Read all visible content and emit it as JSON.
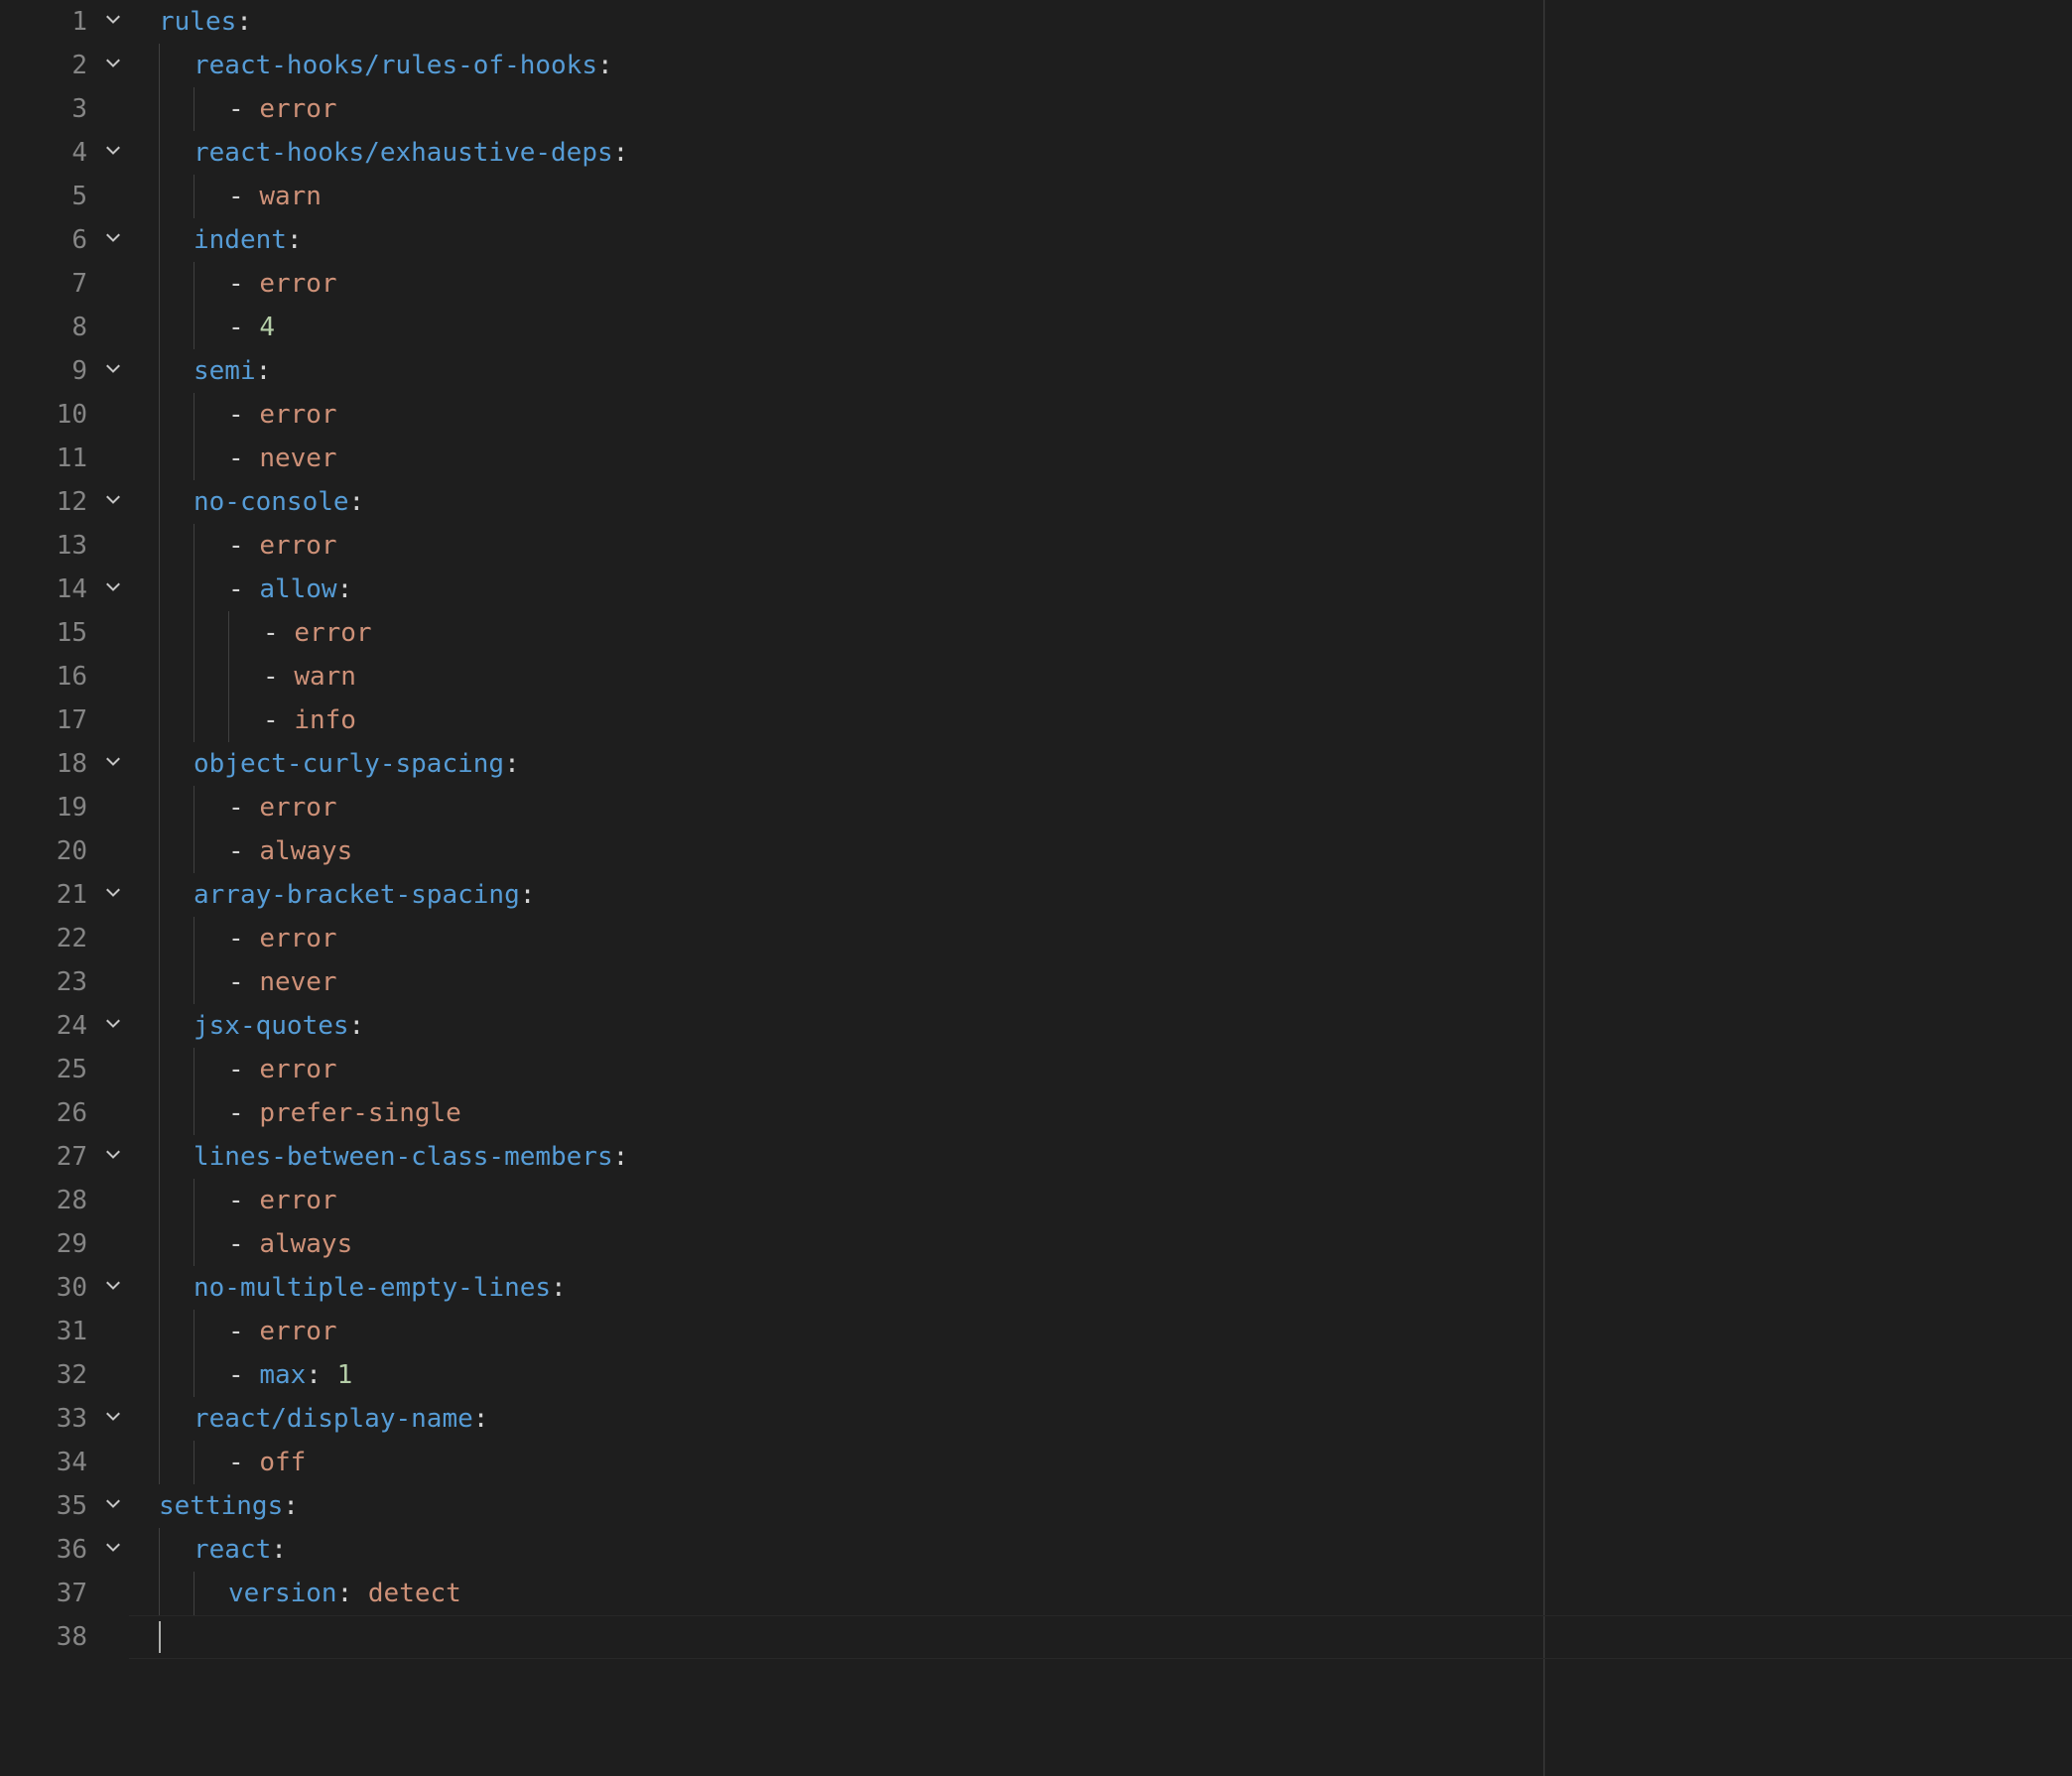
{
  "editor": {
    "ruler_column": 80,
    "current_line": 38,
    "lines": [
      {
        "n": 1,
        "fold": true,
        "indent": 0,
        "guides": [],
        "tokens": [
          [
            "key",
            "rules"
          ],
          [
            "colon",
            ":"
          ]
        ]
      },
      {
        "n": 2,
        "fold": true,
        "indent": 1,
        "guides": [
          0
        ],
        "tokens": [
          [
            "key",
            "react-hooks/rules-of-hooks"
          ],
          [
            "colon",
            ":"
          ]
        ]
      },
      {
        "n": 3,
        "fold": false,
        "indent": 2,
        "guides": [
          0,
          1
        ],
        "tokens": [
          [
            "dash",
            "- "
          ],
          [
            "str",
            "error"
          ]
        ]
      },
      {
        "n": 4,
        "fold": true,
        "indent": 1,
        "guides": [
          0
        ],
        "tokens": [
          [
            "key",
            "react-hooks/exhaustive-deps"
          ],
          [
            "colon",
            ":"
          ]
        ]
      },
      {
        "n": 5,
        "fold": false,
        "indent": 2,
        "guides": [
          0,
          1
        ],
        "tokens": [
          [
            "dash",
            "- "
          ],
          [
            "str",
            "warn"
          ]
        ]
      },
      {
        "n": 6,
        "fold": true,
        "indent": 1,
        "guides": [
          0
        ],
        "tokens": [
          [
            "key",
            "indent"
          ],
          [
            "colon",
            ":"
          ]
        ]
      },
      {
        "n": 7,
        "fold": false,
        "indent": 2,
        "guides": [
          0,
          1
        ],
        "tokens": [
          [
            "dash",
            "- "
          ],
          [
            "str",
            "error"
          ]
        ]
      },
      {
        "n": 8,
        "fold": false,
        "indent": 2,
        "guides": [
          0,
          1
        ],
        "tokens": [
          [
            "dash",
            "- "
          ],
          [
            "num",
            "4"
          ]
        ]
      },
      {
        "n": 9,
        "fold": true,
        "indent": 1,
        "guides": [
          0
        ],
        "tokens": [
          [
            "key",
            "semi"
          ],
          [
            "colon",
            ":"
          ]
        ]
      },
      {
        "n": 10,
        "fold": false,
        "indent": 2,
        "guides": [
          0,
          1
        ],
        "tokens": [
          [
            "dash",
            "- "
          ],
          [
            "str",
            "error"
          ]
        ]
      },
      {
        "n": 11,
        "fold": false,
        "indent": 2,
        "guides": [
          0,
          1
        ],
        "tokens": [
          [
            "dash",
            "- "
          ],
          [
            "str",
            "never"
          ]
        ]
      },
      {
        "n": 12,
        "fold": true,
        "indent": 1,
        "guides": [
          0
        ],
        "tokens": [
          [
            "key",
            "no-console"
          ],
          [
            "colon",
            ":"
          ]
        ]
      },
      {
        "n": 13,
        "fold": false,
        "indent": 2,
        "guides": [
          0,
          1
        ],
        "tokens": [
          [
            "dash",
            "- "
          ],
          [
            "str",
            "error"
          ]
        ]
      },
      {
        "n": 14,
        "fold": true,
        "indent": 2,
        "guides": [
          0,
          1
        ],
        "tokens": [
          [
            "dash",
            "- "
          ],
          [
            "key",
            "allow"
          ],
          [
            "colon",
            ":"
          ]
        ]
      },
      {
        "n": 15,
        "fold": false,
        "indent": 3,
        "guides": [
          0,
          1,
          2
        ],
        "tokens": [
          [
            "dash",
            "- "
          ],
          [
            "str",
            "error"
          ]
        ]
      },
      {
        "n": 16,
        "fold": false,
        "indent": 3,
        "guides": [
          0,
          1,
          2
        ],
        "tokens": [
          [
            "dash",
            "- "
          ],
          [
            "str",
            "warn"
          ]
        ]
      },
      {
        "n": 17,
        "fold": false,
        "indent": 3,
        "guides": [
          0,
          1,
          2
        ],
        "tokens": [
          [
            "dash",
            "- "
          ],
          [
            "str",
            "info"
          ]
        ]
      },
      {
        "n": 18,
        "fold": true,
        "indent": 1,
        "guides": [
          0
        ],
        "tokens": [
          [
            "key",
            "object-curly-spacing"
          ],
          [
            "colon",
            ":"
          ]
        ]
      },
      {
        "n": 19,
        "fold": false,
        "indent": 2,
        "guides": [
          0,
          1
        ],
        "tokens": [
          [
            "dash",
            "- "
          ],
          [
            "str",
            "error"
          ]
        ]
      },
      {
        "n": 20,
        "fold": false,
        "indent": 2,
        "guides": [
          0,
          1
        ],
        "tokens": [
          [
            "dash",
            "- "
          ],
          [
            "str",
            "always"
          ]
        ]
      },
      {
        "n": 21,
        "fold": true,
        "indent": 1,
        "guides": [
          0
        ],
        "tokens": [
          [
            "key",
            "array-bracket-spacing"
          ],
          [
            "colon",
            ":"
          ]
        ]
      },
      {
        "n": 22,
        "fold": false,
        "indent": 2,
        "guides": [
          0,
          1
        ],
        "tokens": [
          [
            "dash",
            "- "
          ],
          [
            "str",
            "error"
          ]
        ]
      },
      {
        "n": 23,
        "fold": false,
        "indent": 2,
        "guides": [
          0,
          1
        ],
        "tokens": [
          [
            "dash",
            "- "
          ],
          [
            "str",
            "never"
          ]
        ]
      },
      {
        "n": 24,
        "fold": true,
        "indent": 1,
        "guides": [
          0
        ],
        "tokens": [
          [
            "key",
            "jsx-quotes"
          ],
          [
            "colon",
            ":"
          ]
        ]
      },
      {
        "n": 25,
        "fold": false,
        "indent": 2,
        "guides": [
          0,
          1
        ],
        "tokens": [
          [
            "dash",
            "- "
          ],
          [
            "str",
            "error"
          ]
        ]
      },
      {
        "n": 26,
        "fold": false,
        "indent": 2,
        "guides": [
          0,
          1
        ],
        "tokens": [
          [
            "dash",
            "- "
          ],
          [
            "str",
            "prefer-single"
          ]
        ]
      },
      {
        "n": 27,
        "fold": true,
        "indent": 1,
        "guides": [
          0
        ],
        "tokens": [
          [
            "key",
            "lines-between-class-members"
          ],
          [
            "colon",
            ":"
          ]
        ]
      },
      {
        "n": 28,
        "fold": false,
        "indent": 2,
        "guides": [
          0,
          1
        ],
        "tokens": [
          [
            "dash",
            "- "
          ],
          [
            "str",
            "error"
          ]
        ]
      },
      {
        "n": 29,
        "fold": false,
        "indent": 2,
        "guides": [
          0,
          1
        ],
        "tokens": [
          [
            "dash",
            "- "
          ],
          [
            "str",
            "always"
          ]
        ]
      },
      {
        "n": 30,
        "fold": true,
        "indent": 1,
        "guides": [
          0
        ],
        "tokens": [
          [
            "key",
            "no-multiple-empty-lines"
          ],
          [
            "colon",
            ":"
          ]
        ]
      },
      {
        "n": 31,
        "fold": false,
        "indent": 2,
        "guides": [
          0,
          1
        ],
        "tokens": [
          [
            "dash",
            "- "
          ],
          [
            "str",
            "error"
          ]
        ]
      },
      {
        "n": 32,
        "fold": false,
        "indent": 2,
        "guides": [
          0,
          1
        ],
        "tokens": [
          [
            "dash",
            "- "
          ],
          [
            "key",
            "max"
          ],
          [
            "colon",
            ": "
          ],
          [
            "num",
            "1"
          ]
        ]
      },
      {
        "n": 33,
        "fold": true,
        "indent": 1,
        "guides": [
          0
        ],
        "tokens": [
          [
            "key",
            "react/display-name"
          ],
          [
            "colon",
            ":"
          ]
        ]
      },
      {
        "n": 34,
        "fold": false,
        "indent": 2,
        "guides": [
          0,
          1
        ],
        "tokens": [
          [
            "dash",
            "- "
          ],
          [
            "str",
            "off"
          ]
        ]
      },
      {
        "n": 35,
        "fold": true,
        "indent": 0,
        "guides": [],
        "tokens": [
          [
            "key",
            "settings"
          ],
          [
            "colon",
            ":"
          ]
        ]
      },
      {
        "n": 36,
        "fold": true,
        "indent": 1,
        "guides": [
          0
        ],
        "tokens": [
          [
            "key",
            "react"
          ],
          [
            "colon",
            ":"
          ]
        ]
      },
      {
        "n": 37,
        "fold": false,
        "indent": 2,
        "guides": [
          0,
          1
        ],
        "tokens": [
          [
            "key",
            "version"
          ],
          [
            "colon",
            ": "
          ],
          [
            "str",
            "detect"
          ]
        ]
      },
      {
        "n": 38,
        "fold": false,
        "indent": 0,
        "guides": [],
        "tokens": [],
        "cursor": true
      }
    ]
  }
}
